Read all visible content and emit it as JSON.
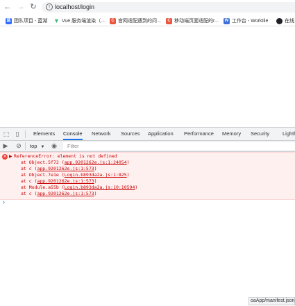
{
  "address_bar": {
    "url": "localhost/login"
  },
  "bookmarks": [
    {
      "label": "团队项目 - 蓝湖",
      "icon": "lanhu-icon",
      "color": "#2f6bff"
    },
    {
      "label": "Vue 服务端渲染（...",
      "icon": "vue-icon",
      "color": "#41b883"
    },
    {
      "label": "官网适配遇到的问...",
      "icon": "csdn-icon",
      "color": "#e9543c"
    },
    {
      "label": "移动端页面适配的r...",
      "icon": "csdn-icon",
      "color": "#e9543c"
    },
    {
      "label": "工作台 - Worktile",
      "icon": "worktile-icon",
      "color": "#3f6fd8"
    },
    {
      "label": "在线",
      "icon": "globe-icon",
      "color": "#202124"
    }
  ],
  "devtools": {
    "tabs": [
      "Elements",
      "Console",
      "Network",
      "Sources",
      "Application",
      "Performance",
      "Memory",
      "Security",
      "Lighth"
    ],
    "active_tab": "Console",
    "context": "top",
    "filter_placeholder": "Filter",
    "error": {
      "message": "ReferenceError: element is not defined",
      "frames": [
        {
          "prefix": "at Object.5f72 (",
          "link": "app.9201262e.js:1:24054",
          "suffix": ")"
        },
        {
          "prefix": "at c (",
          "link": "app.9201262e.js:1:573",
          "suffix": ")"
        },
        {
          "prefix": "at Object.7e1e (",
          "link": "Login.b893da2a.js:1:825",
          "suffix": ")"
        },
        {
          "prefix": "at c (",
          "link": "app.9201262e.js:1:573",
          "suffix": ")"
        },
        {
          "prefix": "at Module.a55b (",
          "link": "Login.b893da2a.js:10:10594",
          "suffix": ")"
        },
        {
          "prefix": "at c (",
          "link": "app.9201262e.js:1:573",
          "suffix": ")"
        }
      ]
    },
    "prompt_symbol": "›"
  },
  "status_text": "oaApp/manifest.json"
}
